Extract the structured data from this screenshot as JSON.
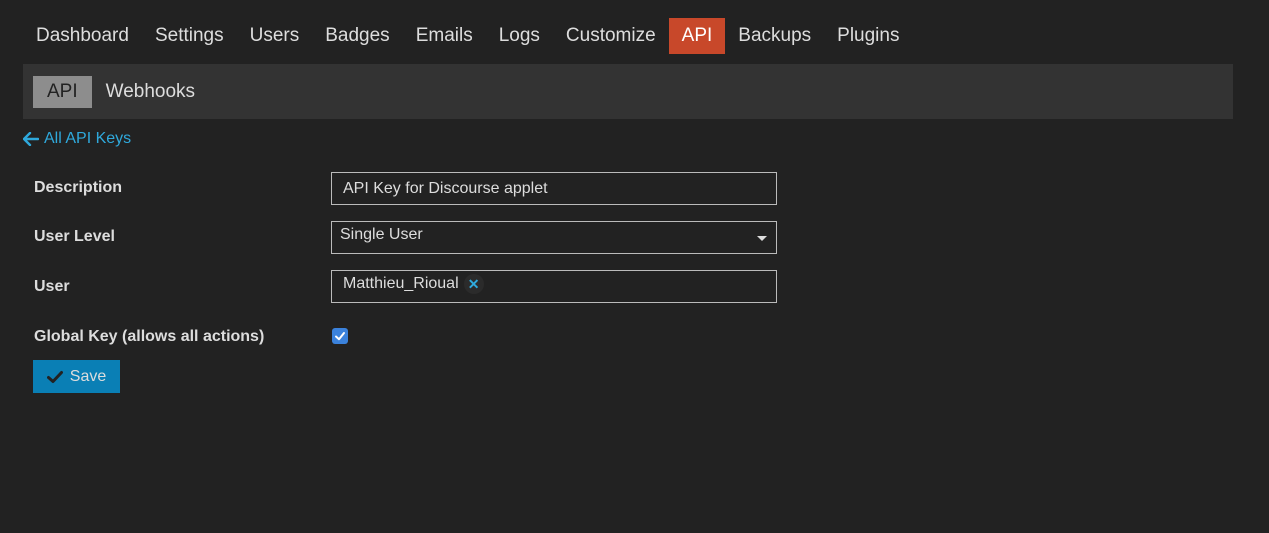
{
  "topnav": {
    "items": [
      {
        "label": "Dashboard"
      },
      {
        "label": "Settings"
      },
      {
        "label": "Users"
      },
      {
        "label": "Badges"
      },
      {
        "label": "Emails"
      },
      {
        "label": "Logs"
      },
      {
        "label": "Customize"
      },
      {
        "label": "API",
        "active": true
      },
      {
        "label": "Backups"
      },
      {
        "label": "Plugins"
      }
    ]
  },
  "subnav": {
    "items": [
      {
        "label": "API",
        "active": true
      },
      {
        "label": "Webhooks"
      }
    ]
  },
  "back_link": {
    "label": "All API Keys",
    "icon": "arrow-left-icon"
  },
  "form": {
    "description": {
      "label": "Description",
      "value": "API Key for Discourse applet"
    },
    "user_level": {
      "label": "User Level",
      "value": "Single User"
    },
    "user": {
      "label": "User",
      "value": "Matthieu_Rioual"
    },
    "global_key": {
      "label": "Global Key (allows all actions)",
      "checked": true
    },
    "save_label": "Save"
  },
  "colors": {
    "background": "#222222",
    "active_tab": "#c8482a",
    "link": "#2fa9dc",
    "primary_button": "#0a7fb5",
    "checkbox": "#3b82dc"
  }
}
